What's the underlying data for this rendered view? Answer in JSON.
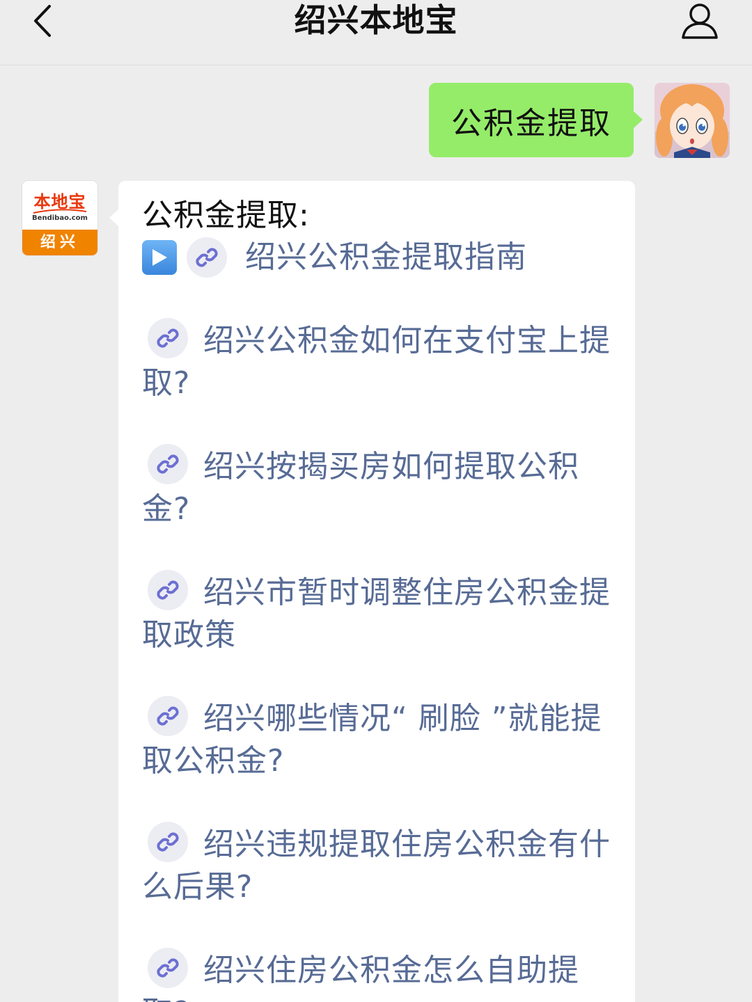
{
  "header": {
    "title": "绍兴本地宝"
  },
  "outgoing": {
    "text": "公积金提取"
  },
  "bot": {
    "logo_main": "本地宝",
    "logo_url": "Bendibao.com",
    "logo_city": "绍兴"
  },
  "incoming": {
    "intro": "公积金提取:",
    "first_link": "绍兴公积金提取指南",
    "links": [
      "绍兴公积金如何在支付宝上提取?",
      "绍兴按揭买房如何提取公积金?",
      "绍兴市暂时调整住房公积金提取政策",
      "绍兴哪些情况“ 刷脸 ”就能提取公积金?",
      "绍兴违规提取住房公积金有什么后果?",
      "绍兴住房公积金怎么自助提取?"
    ]
  },
  "colors": {
    "background": "#ededed",
    "outgoing_bubble": "#95ec69",
    "link": "#576b95",
    "logo_orange": "#f08300",
    "logo_red": "#e8380d"
  },
  "icons": [
    "back-arrow-icon",
    "user-profile-icon",
    "play-icon",
    "link-icon"
  ]
}
